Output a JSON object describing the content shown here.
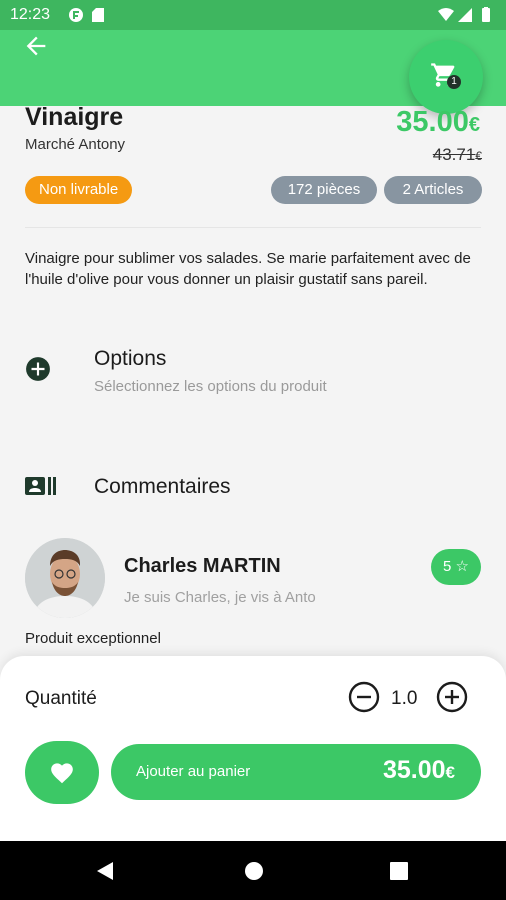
{
  "status_bar": {
    "time": "12:23"
  },
  "product": {
    "title": "Vinaigre",
    "shop": "Marché Antony",
    "price": "35.00",
    "currency": "€",
    "old_price": "43.71",
    "badges": {
      "delivery": "Non livrable",
      "pieces": "172 pièces",
      "articles": "2 Articles"
    },
    "description": "Vinaigre pour sublimer vos salades. Se marie parfaitement avec de l'huile d'olive pour vous donner un plaisir gustatif sans pareil."
  },
  "cart": {
    "count": "1"
  },
  "options": {
    "title": "Options",
    "subtitle": "Sélectionnez les options du produit"
  },
  "comments": {
    "title": "Commentaires",
    "items": [
      {
        "author": "Charles MARTIN",
        "subtitle": "Je suis Charles, je vis à Anto",
        "rating": "5",
        "text": "Produit exceptionnel"
      }
    ]
  },
  "bottom": {
    "quantity_label": "Quantité",
    "quantity_value": "1.0",
    "add_label": "Ajouter au panier",
    "add_price": "35.00",
    "currency": "€"
  },
  "colors": {
    "primary": "#3cc866",
    "appbar": "#4cd376",
    "status_bar": "#3eb65f",
    "orange": "#f59a12",
    "gray_badge": "#8895a1"
  }
}
